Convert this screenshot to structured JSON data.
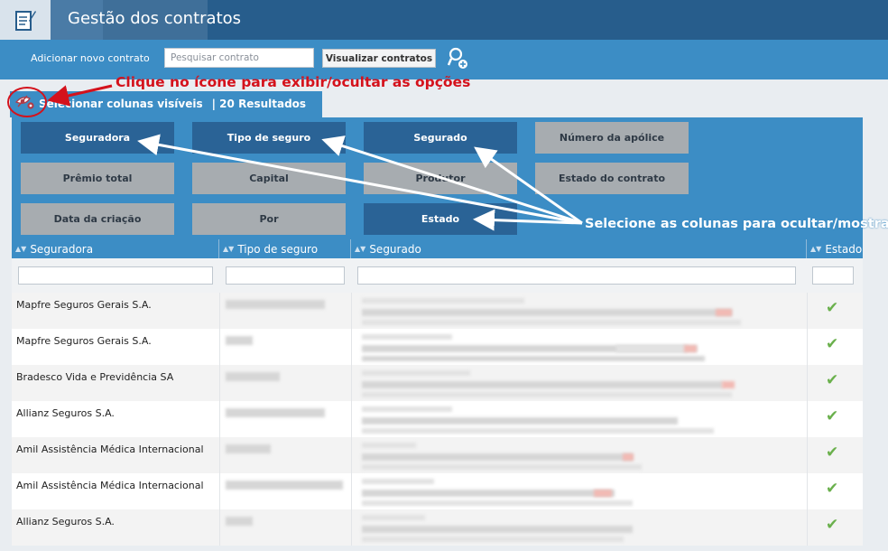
{
  "app": {
    "title": "Gestão dos contratos"
  },
  "toolbar": {
    "add_label": "Adicionar novo contrato",
    "search_placeholder": "Pesquisar contrato",
    "view_button": "Visualizar contratos"
  },
  "columns_tab": {
    "label": "Selecionar colunas visíveis",
    "results": "| 20 Resultados"
  },
  "column_chips": [
    {
      "label": "Seguradora",
      "visible": true
    },
    {
      "label": "Tipo de seguro",
      "visible": true
    },
    {
      "label": "Segurado",
      "visible": true
    },
    {
      "label": "Número da apólice",
      "visible": false
    },
    {
      "label": "Prêmio total",
      "visible": false
    },
    {
      "label": "Capital",
      "visible": false
    },
    {
      "label": "Produtor",
      "visible": false
    },
    {
      "label": "Estado do contrato",
      "visible": false
    },
    {
      "label": "Data da criação",
      "visible": false
    },
    {
      "label": "Por",
      "visible": false
    },
    {
      "label": "Estado",
      "visible": true
    }
  ],
  "grid": {
    "headers": [
      "Seguradora",
      "Tipo de seguro",
      "Segurado",
      "Estado"
    ],
    "rows": [
      {
        "seguradora": "Mapfre Seguros Gerais S.A."
      },
      {
        "seguradora": "Mapfre Seguros Gerais S.A."
      },
      {
        "seguradora": "Bradesco Vida e Previdência SA"
      },
      {
        "seguradora": "Allianz Seguros S.A."
      },
      {
        "seguradora": "Amil Assistência Médica Internacional"
      },
      {
        "seguradora": "Amil Assistência Médica Internacional"
      },
      {
        "seguradora": "Allianz Seguros S.A."
      }
    ],
    "status_icon": "check-icon",
    "status_color": "#6ab04c"
  },
  "annotations": {
    "click_hint": "Clique no ícone para exibir/ocultar as opções",
    "select_hint": "Selecione as colunas para ocultar/mostrar",
    "color_red": "#d4121c"
  },
  "colors": {
    "header": "#275d8c",
    "accent": "#3c8dc5",
    "chip_on": "#2a6396",
    "chip_off": "#a7acb0"
  }
}
